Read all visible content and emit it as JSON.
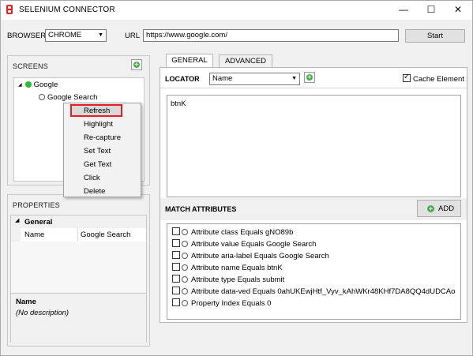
{
  "window": {
    "title": "SELENIUM CONNECTOR",
    "controls": {
      "minimize": "—",
      "maximize": "☐",
      "close": "✕"
    },
    "icon": "selenium-logo-icon"
  },
  "toolbar": {
    "browser_label": "BROWSER",
    "browser_value": "CHROME",
    "url_label": "URL",
    "url_value": "https://www.google.com/",
    "start_label": "Start"
  },
  "screens": {
    "header": "SCREENS",
    "add_icon": "add-icon",
    "tree": {
      "root": {
        "label": "Google",
        "status_color": "#23c12b"
      },
      "child": {
        "label": "Google Search"
      }
    }
  },
  "context_menu": {
    "items": [
      "Refresh",
      "Highlight",
      "Re-capture",
      "Set Text",
      "Get Text",
      "Click",
      "Delete"
    ],
    "selected": "Refresh",
    "highlight_color": "#e31e25"
  },
  "properties": {
    "header": "PROPERTIES",
    "section": "General",
    "rows": [
      {
        "name": "Name",
        "value": "Google Search"
      }
    ],
    "description_title": "Name",
    "description_text": "(No description)"
  },
  "tabs": [
    {
      "label": "GENERAL",
      "active": true
    },
    {
      "label": "ADVANCED",
      "active": false
    }
  ],
  "locator": {
    "label": "LOCATOR",
    "type_value": "Name",
    "cache_label": "Cache Element",
    "cache_checked": true,
    "value": "btnK"
  },
  "match_attributes": {
    "header": "MATCH ATTRIBUTES",
    "add_label": "ADD",
    "items": [
      "Attribute class Equals gNO89b",
      "Attribute value Equals Google Search",
      "Attribute aria-label Equals Google Search",
      "Attribute name Equals btnK",
      "Attribute type Equals submit",
      "Attribute data-ved Equals 0ahUKEwjHtf_Vyv_kAhWKr48KHf7DA8QQ4dUDCAo",
      "Property Index Equals 0"
    ]
  }
}
